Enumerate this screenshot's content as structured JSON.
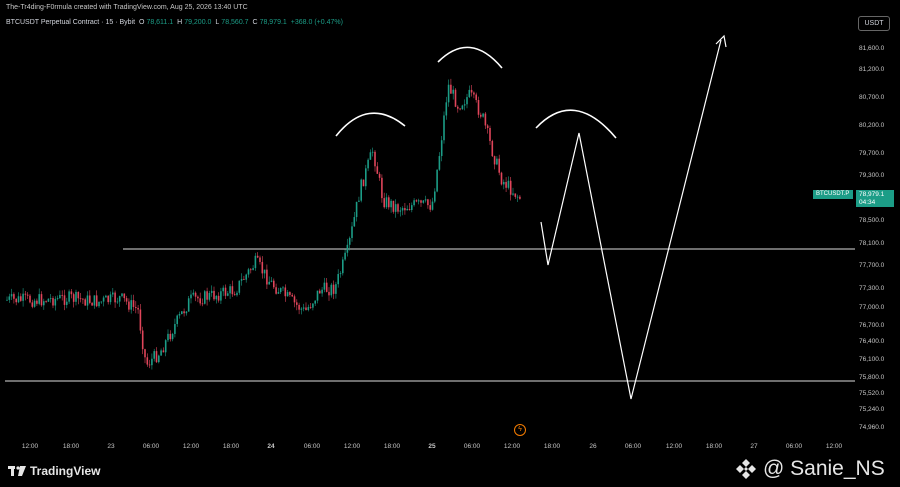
{
  "header": {
    "created_line": "The-Tr4ding-F0rmula created with TradingView.com, Aug 25, 2026 13:40 UTC",
    "symbol_desc": "BTCUSDT Perpetual Contract · 15 · Bybit",
    "ohlc": {
      "o_label": "O",
      "o": "78,611.1",
      "h_label": "H",
      "h": "79,200.0",
      "l_label": "L",
      "l": "78,560.7",
      "c_label": "C",
      "c": "78,979.1",
      "change": "+368.0 (+0.47%)"
    },
    "currency_button": "USDT"
  },
  "price_axis": [
    "81,600.0",
    "81,200.0",
    "80,700.0",
    "80,200.0",
    "79,700.0",
    "79,300.0",
    "78,500.0",
    "78,100.0",
    "77,700.0",
    "77,300.0",
    "77,000.0",
    "76,700.0",
    "76,400.0",
    "76,100.0",
    "75,800.0",
    "75,520.0",
    "75,240.0",
    "74,960.0"
  ],
  "current_price": {
    "symbol_tag": "BTCUSDT.P",
    "price": "78,979.1",
    "countdown": "04:34"
  },
  "time_axis": [
    "12:00",
    "18:00",
    "23",
    "06:00",
    "12:00",
    "18:00",
    "24",
    "06:00",
    "12:00",
    "18:00",
    "25",
    "06:00",
    "12:00",
    "18:00",
    "26",
    "06:00",
    "12:00",
    "18:00",
    "27",
    "06:00",
    "12:00"
  ],
  "footer": {
    "brand": "TradingView",
    "watermark": "@ Sanie_NS"
  },
  "colors": {
    "up": "#1c9d87",
    "down": "#e0455a",
    "background": "#000000",
    "line": "#ffffff"
  }
}
